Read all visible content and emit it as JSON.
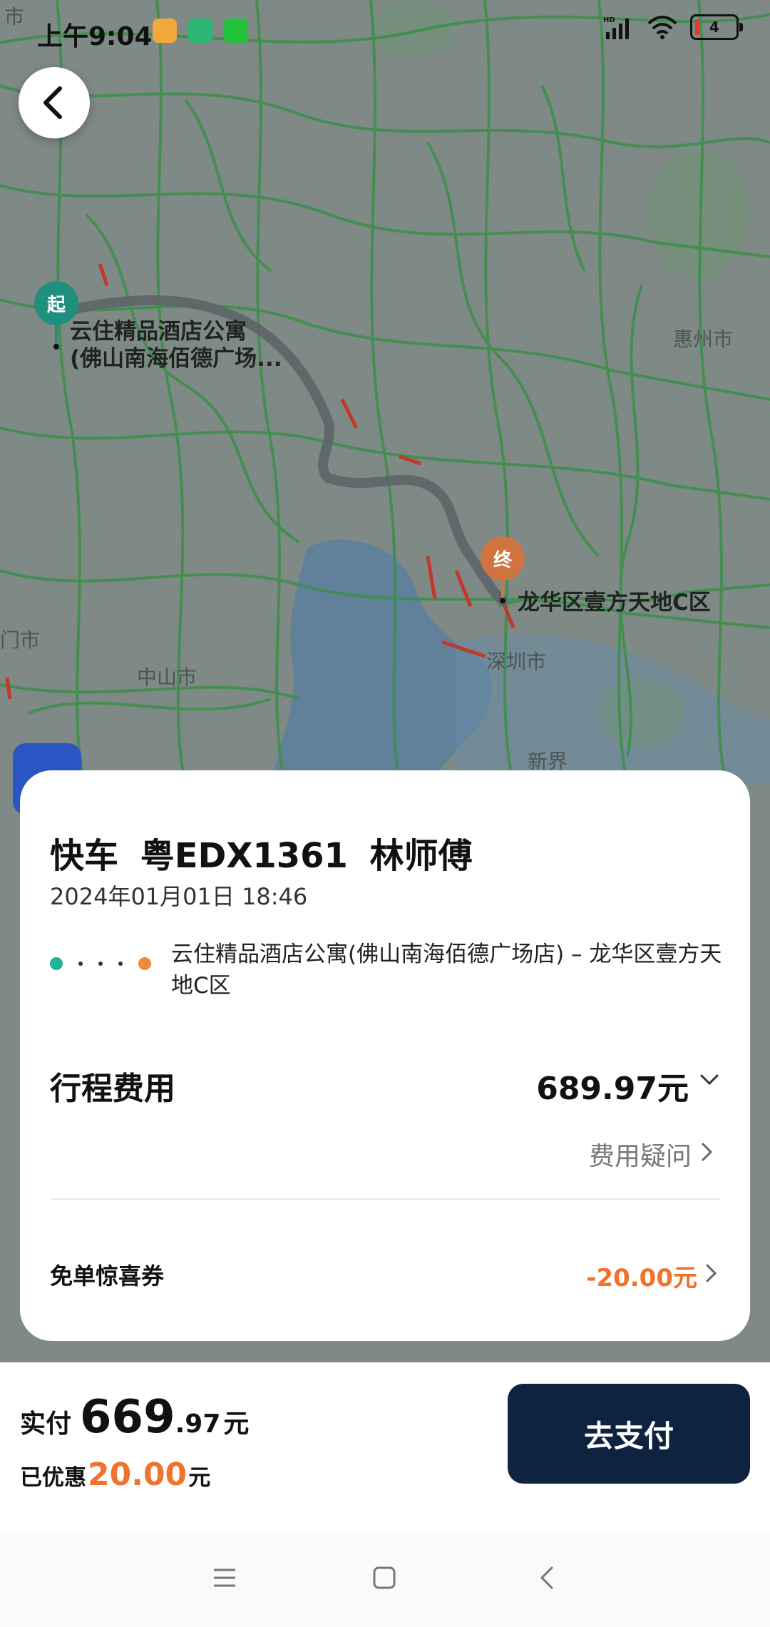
{
  "status_bar": {
    "time": "上午9:04",
    "battery": "4",
    "app_icons": [
      "notes-icon",
      "security-icon",
      "wechat-icon"
    ]
  },
  "map": {
    "start_pin": "起",
    "end_pin": "终",
    "start_label_line1": "云住精品酒店公寓",
    "start_label_line2": "(佛山南海佰德广场...",
    "end_label": "龙华区壹方天地C区",
    "cities": {
      "huizhou": "惠州市",
      "zhongshan": "中山市",
      "shenzhen": "深圳市",
      "xinjie": "新界",
      "left_partial": "门市",
      "top_partial": "市"
    }
  },
  "trip": {
    "title": "快车 粤EDX1361 林师傅",
    "date": "2024年01月01日 18:46",
    "route": "云住精品酒店公寓(佛山南海佰德广场店) – 龙华区壹方天地C区",
    "fee_label": "行程费用",
    "fee_amount": "689.97元",
    "fee_question": "费用疑问",
    "coupon_label": "免单惊喜券",
    "coupon_value": "-20.00元"
  },
  "payment": {
    "paid_label": "实付",
    "paid_integer": "669",
    "paid_decimal": ".97",
    "paid_unit": "元",
    "discount_label": "已优惠",
    "discount_value": "20.00",
    "discount_unit": "元",
    "pay_button": "去支付"
  },
  "colors": {
    "start": "#22b29a",
    "end": "#f08a3a",
    "accent": "#f0722d",
    "pay_button": "#0e2340"
  }
}
